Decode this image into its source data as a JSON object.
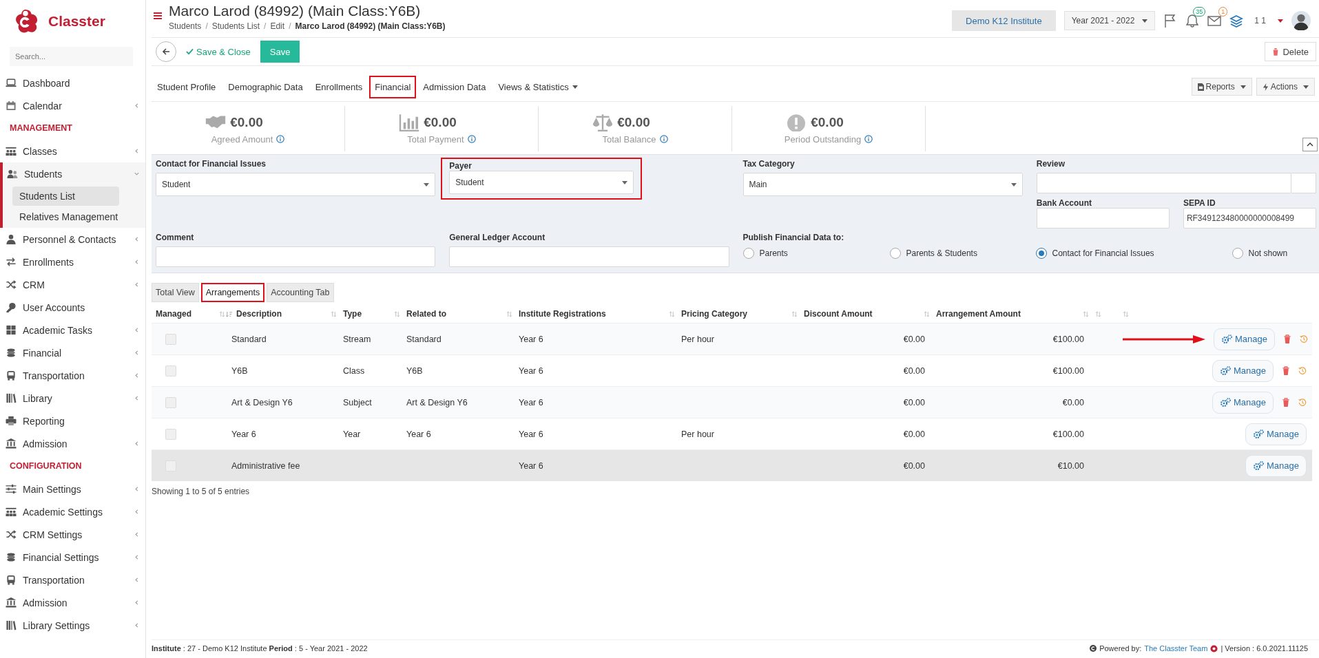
{
  "sidebar": {
    "logo": "Classter",
    "search": {
      "placeholder": "Search..."
    },
    "items": [
      {
        "kind": "item",
        "label": "Dashboard",
        "selected": false
      },
      {
        "kind": "item",
        "label": "Calendar",
        "selected": false,
        "expanded": false
      },
      {
        "kind": "heading",
        "label": "MANAGEMENT"
      },
      {
        "kind": "item",
        "label": "Classes",
        "selected": false,
        "expanded": false
      },
      {
        "kind": "item",
        "label": "Students",
        "selected": true,
        "expanded": true,
        "children": [
          {
            "label": "Students List",
            "selected": true
          },
          {
            "label": "Relatives Management",
            "selected": false
          }
        ]
      },
      {
        "kind": "item",
        "label": "Personnel & Contacts",
        "selected": false,
        "expanded": false
      },
      {
        "kind": "item",
        "label": "Enrollments",
        "selected": false,
        "expanded": false
      },
      {
        "kind": "item",
        "label": "CRM",
        "selected": false,
        "expanded": false
      },
      {
        "kind": "item",
        "label": "User Accounts",
        "selected": false
      },
      {
        "kind": "item",
        "label": "Academic Tasks",
        "selected": false,
        "expanded": false
      },
      {
        "kind": "item",
        "label": "Financial",
        "selected": false,
        "expanded": false
      },
      {
        "kind": "item",
        "label": "Transportation",
        "selected": false,
        "expanded": false
      },
      {
        "kind": "item",
        "label": "Library",
        "selected": false,
        "expanded": false
      },
      {
        "kind": "item",
        "label": "Reporting",
        "selected": false
      },
      {
        "kind": "item",
        "label": "Admission",
        "selected": false,
        "expanded": false
      },
      {
        "kind": "heading",
        "label": "CONFIGURATION"
      },
      {
        "kind": "item",
        "label": "Main Settings",
        "selected": false,
        "expanded": false
      },
      {
        "kind": "item",
        "label": "Academic Settings",
        "selected": false,
        "expanded": false
      },
      {
        "kind": "item",
        "label": "CRM Settings",
        "selected": false,
        "expanded": false
      },
      {
        "kind": "item",
        "label": "Financial Settings",
        "selected": false,
        "expanded": false
      },
      {
        "kind": "item",
        "label": "Transportation",
        "selected": false,
        "expanded": false
      },
      {
        "kind": "item",
        "label": "Admission",
        "selected": false,
        "expanded": false
      },
      {
        "kind": "item",
        "label": "Library Settings",
        "selected": false,
        "expanded": false
      }
    ]
  },
  "header": {
    "title": "Marco Larod (84992) (Main Class:Y6B)",
    "separator": "/",
    "breadcrumb": [
      {
        "label": "Students",
        "current": false
      },
      {
        "label": "Students List",
        "current": false
      },
      {
        "label": "Edit",
        "current": false
      },
      {
        "label": "Marco Larod (84992) (Main Class:Y6B)",
        "current": true
      }
    ],
    "institute": "Demo K12 Institute",
    "year": "Year 2021 - 2022",
    "notifications": "35",
    "messages": "1",
    "user": "1 1"
  },
  "toolbar": {
    "save_close": "Save & Close",
    "save": "Save",
    "delete": "Delete"
  },
  "tabs": [
    {
      "label": "Student Profile",
      "highlighted": false,
      "dropdown": false
    },
    {
      "label": "Demographic Data",
      "highlighted": false,
      "dropdown": false
    },
    {
      "label": "Enrollments",
      "highlighted": false,
      "dropdown": false
    },
    {
      "label": "Financial",
      "highlighted": true,
      "dropdown": false
    },
    {
      "label": "Admission Data",
      "highlighted": false,
      "dropdown": false
    },
    {
      "label": "Views & Statistics",
      "highlighted": false,
      "dropdown": true
    }
  ],
  "tab_actions": [
    {
      "kind": "reports",
      "label": "Reports"
    },
    {
      "kind": "actions",
      "label": "Actions"
    }
  ],
  "summary": [
    {
      "kind": "agreed",
      "amount": "€0.00",
      "label": "Agreed Amount"
    },
    {
      "kind": "payment",
      "amount": "€0.00",
      "label": "Total Payment"
    },
    {
      "kind": "balance",
      "amount": "€0.00",
      "label": "Total Balance"
    },
    {
      "kind": "outstanding",
      "amount": "€0.00",
      "label": "Period Outstanding"
    }
  ],
  "financial_form": {
    "contact": {
      "label": "Contact for Financial Issues",
      "value": "Student",
      "highlighted": false
    },
    "payer": {
      "label": "Payer",
      "value": "Student",
      "highlighted": true
    },
    "tax_category": {
      "label": "Tax Category",
      "value": "Main",
      "highlighted": false
    },
    "review": {
      "label": "Review"
    },
    "bank_account": {
      "label": "Bank Account"
    },
    "sepa_id": {
      "label": "SEPA ID",
      "value": "RF349123480000000008499"
    },
    "comment": {
      "label": "Comment"
    },
    "ledger_account": {
      "label": "General Ledger Account"
    },
    "publish": {
      "label": "Publish Financial Data to:",
      "options": [
        {
          "label": "Parents",
          "selected": false
        },
        {
          "label": "Parents & Students",
          "selected": false
        },
        {
          "label": "Contact for Financial Issues",
          "selected": true
        },
        {
          "label": "Not shown",
          "selected": false
        }
      ]
    }
  },
  "sub_tabs": [
    {
      "label": "Total View",
      "selected": false,
      "highlighted": false
    },
    {
      "label": "Arrangements",
      "selected": true,
      "highlighted": true
    },
    {
      "label": "Accounting Tab",
      "selected": false,
      "highlighted": false
    }
  ],
  "table": {
    "columns": [
      "Managed",
      "Description",
      "Type",
      "Related to",
      "Institute Registrations",
      "Pricing Category",
      "Discount Amount",
      "Arrangement Amount"
    ],
    "rows": [
      {
        "managed": false,
        "description": "Standard",
        "type": "Stream",
        "related_to": "Standard",
        "registrations": "Year 6",
        "pricing": "Per hour",
        "discount": "€0.00",
        "amount": "€100.00",
        "selected": false,
        "arrow": true,
        "actions": [
          {
            "kind": "manage",
            "label": "Manage"
          },
          {
            "kind": "delete"
          },
          {
            "kind": "history"
          }
        ]
      },
      {
        "managed": false,
        "description": "Y6B",
        "type": "Class",
        "related_to": "Y6B",
        "registrations": "Year 6",
        "discount": "€0.00",
        "amount": "€100.00",
        "selected": false,
        "arrow": false,
        "actions": [
          {
            "kind": "manage",
            "label": "Manage"
          },
          {
            "kind": "delete"
          },
          {
            "kind": "history"
          }
        ]
      },
      {
        "managed": false,
        "description": "Art & Design Y6",
        "type": "Subject",
        "related_to": "Art & Design Y6",
        "registrations": "Year 6",
        "discount": "€0.00",
        "amount": "€0.00",
        "selected": false,
        "arrow": false,
        "actions": [
          {
            "kind": "manage",
            "label": "Manage"
          },
          {
            "kind": "delete"
          },
          {
            "kind": "history"
          }
        ]
      },
      {
        "managed": false,
        "description": "Year 6",
        "type": "Year",
        "related_to": "Year 6",
        "registrations": "Year 6",
        "pricing": "Per hour",
        "discount": "€0.00",
        "amount": "€100.00",
        "selected": false,
        "arrow": false,
        "actions": [
          {
            "kind": "manage",
            "label": "Manage"
          }
        ]
      },
      {
        "managed": false,
        "description": "Administrative fee",
        "registrations": "Year 6",
        "discount": "€0.00",
        "amount": "€10.00",
        "selected": true,
        "arrow": false,
        "actions": [
          {
            "kind": "manage",
            "label": "Manage"
          }
        ]
      }
    ],
    "entries": "Showing 1 to 5 of 5 entries"
  },
  "footer": {
    "info": "**Institute** : 27 - Demo K12 Institute **Period** : 5 - Year 2021 - 2022",
    "powered": "Powered by:",
    "team": "The Classter Team",
    "version": "| Version : 6.0.2021.11125"
  }
}
